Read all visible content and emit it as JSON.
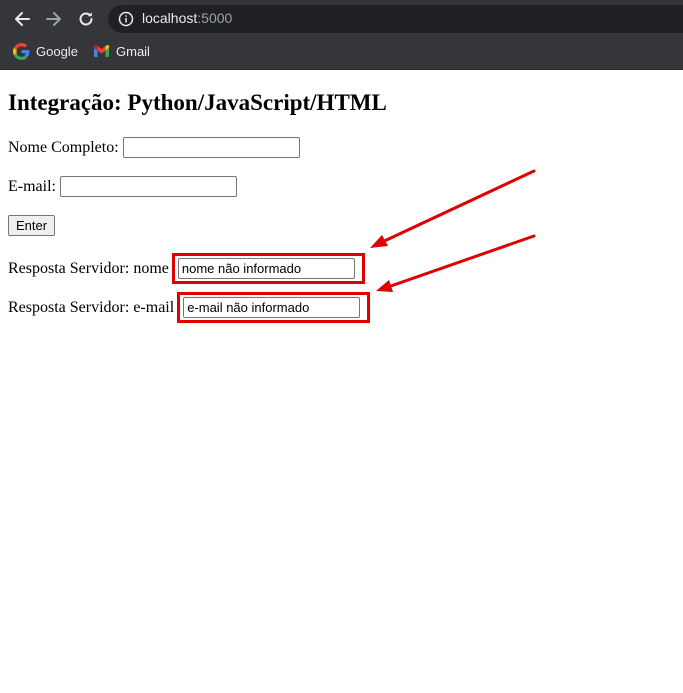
{
  "browser": {
    "url_host": "localhost",
    "url_port": ":5000",
    "bookmarks": [
      {
        "label": "Google",
        "icon": "google-icon"
      },
      {
        "label": "Gmail",
        "icon": "gmail-icon"
      }
    ]
  },
  "page": {
    "title": "Integração: Python/JavaScript/HTML",
    "form": {
      "nome_label": "Nome Completo:",
      "nome_value": "",
      "email_label": "E-mail:",
      "email_value": "",
      "enter_label": "Enter"
    },
    "response": {
      "nome_label": "Resposta Servidor: nome",
      "nome_value": "nome não informado",
      "email_label": "Resposta Servidor: e-mail",
      "email_value": "e-mail não informado"
    }
  },
  "annotations": {
    "highlight_color": "#e00000",
    "arrows": 2
  }
}
